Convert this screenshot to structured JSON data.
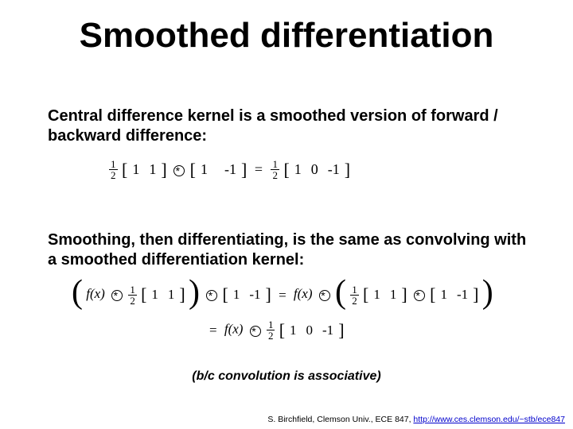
{
  "title": "Smoothed differentiation",
  "para1": "Central difference kernel is a smoothed version of forward / backward difference:",
  "para2": "Smoothing, then differentiating, is the same as convolving with a smoothed differentiation kernel:",
  "note": "(b/c convolution is associative)",
  "eq1": {
    "half_num": "1",
    "half_den": "2",
    "k11": "1",
    "k12": "1",
    "k21": "1",
    "k22": "-1",
    "r1": "1",
    "r2": "0",
    "r3": "-1"
  },
  "eq2": {
    "fx": "f(x)",
    "half_num": "1",
    "half_den": "2",
    "a1": "1",
    "a2": "1",
    "b1": "1",
    "b2": "-1",
    "c1": "1",
    "c2": "1",
    "d1": "1",
    "d2": "-1",
    "r1": "1",
    "r2": "0",
    "r3": "-1"
  },
  "footer": {
    "prefix": "S. Birchfield, Clemson Univ., ECE 847, ",
    "link_text": "http://www.ces.clemson.edu/~stb/ece847",
    "link_href": "http://www.ces.clemson.edu/~stb/ece847"
  }
}
